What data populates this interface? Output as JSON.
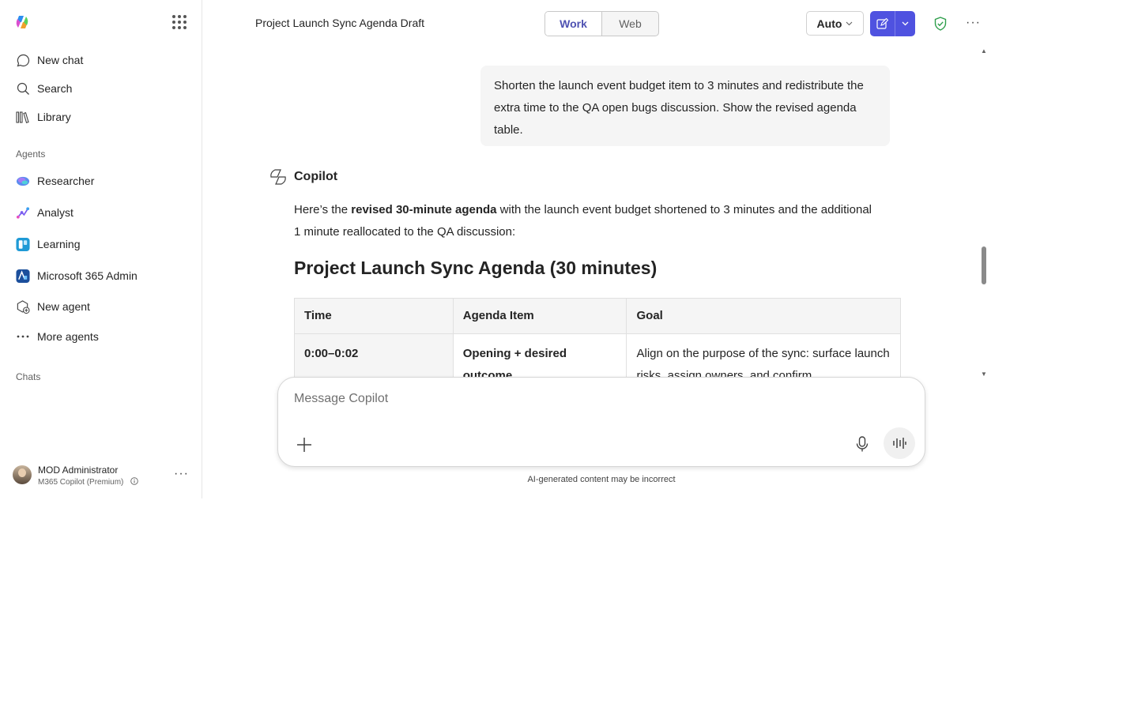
{
  "sidebar": {
    "nav": [
      {
        "label": "New chat",
        "icon": "chat-bubble-icon"
      },
      {
        "label": "Search",
        "icon": "search-icon"
      },
      {
        "label": "Library",
        "icon": "library-icon"
      }
    ],
    "agents_label": "Agents",
    "agents": [
      {
        "label": "Researcher",
        "icon": "researcher-icon"
      },
      {
        "label": "Analyst",
        "icon": "analyst-icon"
      },
      {
        "label": "Learning",
        "icon": "learning-icon"
      },
      {
        "label": "Microsoft 365 Admin",
        "icon": "admin-icon"
      },
      {
        "label": "New agent",
        "icon": "new-agent-icon"
      },
      {
        "label": "More agents",
        "icon": "more-icon"
      }
    ],
    "chats_label": "Chats",
    "user": {
      "name": "MOD Administrator",
      "plan": "M365 Copilot (Premium)"
    }
  },
  "header": {
    "title": "Project Launch Sync Agenda Draft",
    "toggle": {
      "work": "Work",
      "web": "Web",
      "active": "Work"
    },
    "model": "Auto",
    "colors": {
      "accent": "#4f52e0",
      "work_text": "#4f52b2",
      "shield": "#2e9e4b"
    }
  },
  "chat": {
    "user_message": "Shorten the launch event budget item to 3 minutes and redistribute the extra time to the QA open bugs discussion. Show the revised agenda table.",
    "assistant_name": "Copilot",
    "answer_pre": "Here’s the ",
    "answer_bold": "revised 30-minute agenda",
    "answer_post": " with the launch event budget shortened to 3 minutes and the additional 1 minute reallocated to the QA discussion:",
    "agenda_title": "Project Launch Sync Agenda (30 minutes)",
    "table": {
      "headers": [
        "Time",
        "Agenda Item",
        "Goal"
      ],
      "rows": [
        {
          "time": "0:00–0:02",
          "item": "Opening + desired outcome",
          "goal": "Align on the purpose of the sync: surface launch risks, assign owners, and confirm"
        }
      ]
    }
  },
  "composer": {
    "placeholder": "Message Copilot",
    "disclaimer": "AI-generated content may be incorrect"
  }
}
